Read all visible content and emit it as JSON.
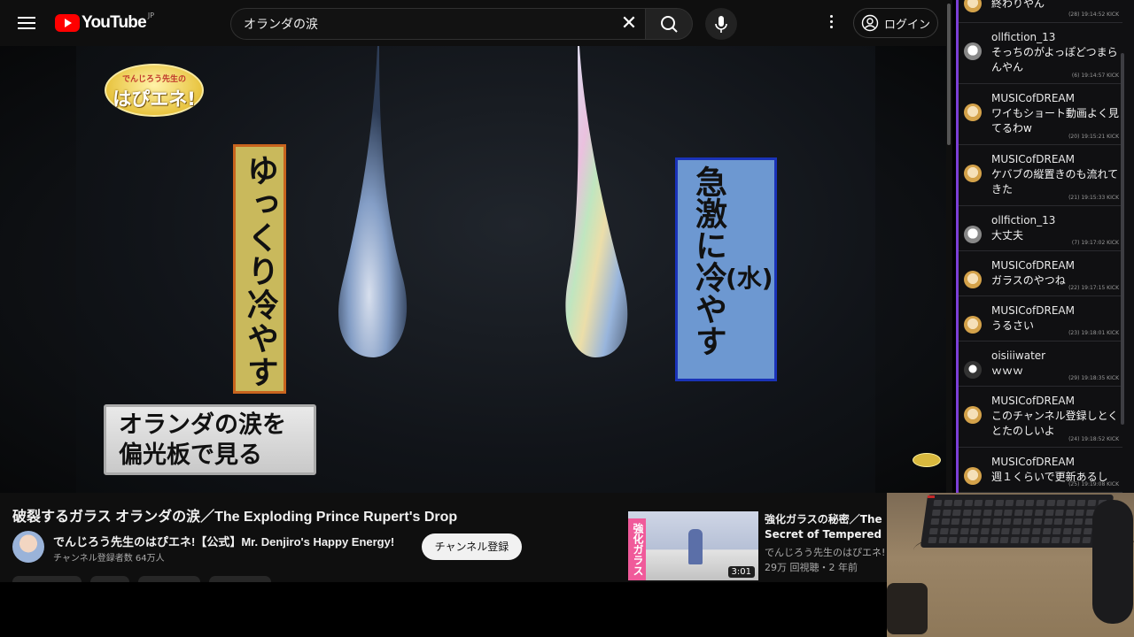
{
  "masthead": {
    "logo_text": "YouTube",
    "logo_country": "JP",
    "search_value": "オランダの涙",
    "login_label": "ログイン"
  },
  "video": {
    "show_logo_top": "でんじろう先生の",
    "show_logo_main": "はぴエネ!",
    "left_label": "ゆっくり冷やす",
    "right_label": "急激に冷やす",
    "right_label_sub": "(水)",
    "caption_line1": "オランダの涙を",
    "caption_line2": "偏光板で見る"
  },
  "info": {
    "title": "破裂するガラス オランダの涙／The Exploding Prince Rupert's Drop",
    "channel_name": "でんじろう先生のはぴエネ!【公式】Mr. Denjiro's Happy Energy!",
    "subscribers": "チャンネル登録者数 64万人",
    "subscribe_label": "チャンネル登録"
  },
  "recommended": {
    "thumb_tag": "強化ガラス",
    "duration": "3:01",
    "title": "強化ガラスの秘密／The Secret of Tempered Glass",
    "channel": "でんじろう先生のはぴエネ!【",
    "meta": "29万 回視聴・2 年前"
  },
  "chat": {
    "messages": [
      {
        "user": "",
        "text": "終わりやん",
        "stamp": "(28)  19:14:52  KICK",
        "avatar": "gold"
      },
      {
        "user": "ollfiction_13",
        "text": "そっちのがよっぽどつまらんやん",
        "stamp": "(6)  19:14:57  KICK",
        "avatar": "gray"
      },
      {
        "user": "MUSICofDREAM",
        "text": "ワイもショート動画よく見てるわw",
        "stamp": "(20)  19:15:21  KICK",
        "avatar": "gold"
      },
      {
        "user": "MUSICofDREAM",
        "text": "ケバブの縦置きのも流れてきた",
        "stamp": "(21)  19:15:33  KICK",
        "avatar": "gold"
      },
      {
        "user": "ollfiction_13",
        "text": "大丈夫",
        "stamp": "(7)  19:17:02  KICK",
        "avatar": "gray"
      },
      {
        "user": "MUSICofDREAM",
        "text": "ガラスのやつね",
        "stamp": "(22)  19:17:15  KICK",
        "avatar": "gold"
      },
      {
        "user": "MUSICofDREAM",
        "text": "うるさい",
        "stamp": "(23)  19:18:01  KICK",
        "avatar": "gold"
      },
      {
        "user": "oisiiiwater",
        "text": "ｗｗｗ",
        "stamp": "(29)  19:18:35  KICK",
        "avatar": "dark"
      },
      {
        "user": "MUSICofDREAM",
        "text": "このチャンネル登録しとくとたのしいよ",
        "stamp": "(24)  19:18:52  KICK",
        "avatar": "gold"
      },
      {
        "user": "MUSICofDREAM",
        "text": "週１くらいで更新あるし",
        "stamp": "(25)  19:19:08  KICK",
        "avatar": "gold"
      }
    ]
  },
  "colors": {
    "page_bg": "#0f0f0f",
    "brand_red": "#ff0000",
    "chat_accent": "#7b3fd6",
    "slow_box": "#c9b95c",
    "rapid_box": "#6d98d1"
  }
}
